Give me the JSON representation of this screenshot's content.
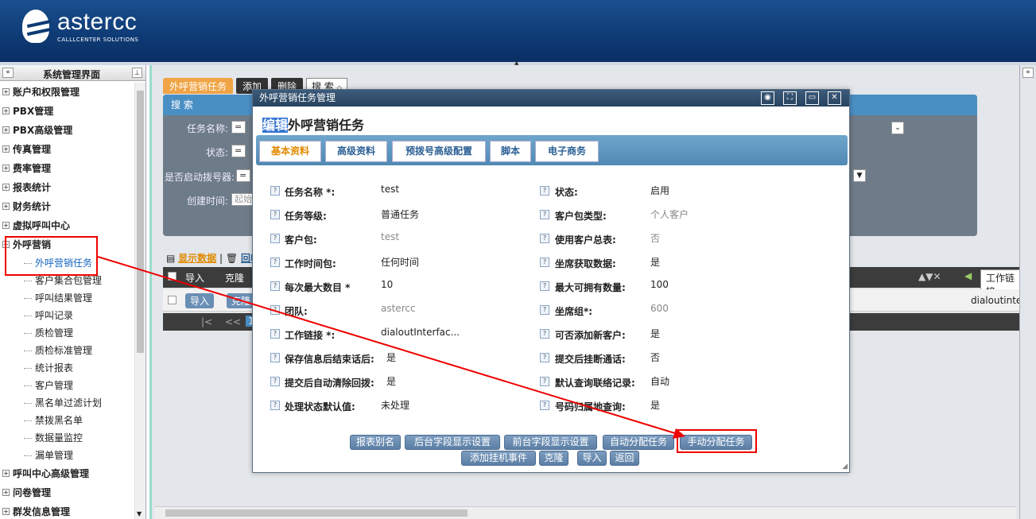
{
  "brand": {
    "name": "astercc",
    "tagline": "CALLLCENTER SOLUTIONS"
  },
  "sidebar": {
    "title": "系统管理界面",
    "items": [
      "账户和权限管理",
      "PBX管理",
      "PBX高级管理",
      "传真管理",
      "费率管理",
      "报表统计",
      "财务统计",
      "虚拟呼叫中心",
      "外呼营销"
    ],
    "subitems": [
      "外呼营销任务",
      "客户集合包管理",
      "呼叫结果管理",
      "呼叫记录",
      "质检管理",
      "质检标准管理",
      "统计报表",
      "客户管理",
      "黑名单过滤计划",
      "禁拨黑名单",
      "数据量监控",
      "漏单管理"
    ],
    "items_after": [
      "呼叫中心高级管理",
      "问卷管理",
      "群发信息管理"
    ]
  },
  "main": {
    "tab": "外呼营销任务",
    "add": "添加",
    "delete": "删除",
    "search_dropdown": "搜 索",
    "search_title": "搜 索",
    "filters": {
      "task_name": "任务名称:",
      "status": "状态:",
      "dialer_enabled": "是否启动拨号器:",
      "created": "创建时间:",
      "eq": "=",
      "start_placeholder": "起始"
    },
    "show_data": "显示数据",
    "recycle": "回收",
    "grid_import": "导入",
    "grid_clone": "克隆",
    "grid_link_col": "工作链接",
    "grid_link_val": "dialoutinte",
    "pager_first": "|<",
    "pager_prev": "<<",
    "pager_page": "1"
  },
  "modal": {
    "window_title": "外呼营销任务管理",
    "heading_highlight": "编辑",
    "heading_rest": "外呼营销任务",
    "tabs": [
      "基本资料",
      "高级资料",
      "预拨号高级配置",
      "脚本",
      "电子商务"
    ],
    "left_fields": [
      {
        "label": "任务名称 *:",
        "value": "test"
      },
      {
        "label": "任务等级:",
        "value": "普通任务"
      },
      {
        "label": "客户包:",
        "value": "test"
      },
      {
        "label": "工作时间包:",
        "value": "任何时间"
      },
      {
        "label": "每次最大数目 *",
        "value": "10"
      },
      {
        "label": "团队:",
        "value": "astercc"
      },
      {
        "label": "工作链接 *:",
        "value": "dialoutInterfac..."
      },
      {
        "label": "保存信息后结束话后:",
        "value": "是"
      },
      {
        "label": "提交后自动清除回拨:",
        "value": "是"
      },
      {
        "label": "处理状态默认值:",
        "value": "未处理"
      }
    ],
    "right_fields": [
      {
        "label": "状态:",
        "value": "启用"
      },
      {
        "label": "客户包类型:",
        "value": "个人客户"
      },
      {
        "label": "使用客户总表:",
        "value": "否"
      },
      {
        "label": "坐席获取数据:",
        "value": "是"
      },
      {
        "label": "最大可拥有数量:",
        "value": "100"
      },
      {
        "label": "坐席组*:",
        "value": "600"
      },
      {
        "label": "可否添加新客户:",
        "value": "是"
      },
      {
        "label": "提交后挂断通话:",
        "value": "否"
      },
      {
        "label": "默认查询联络记录:",
        "value": "自动"
      },
      {
        "label": "号码归属地查询:",
        "value": "是"
      }
    ],
    "buttons_row1": [
      "报表别名",
      "后台字段显示设置",
      "前台字段显示设置",
      "自动分配任务",
      "手动分配任务"
    ],
    "buttons_row2": [
      "添加挂机事件",
      "克隆",
      "导入",
      "返回"
    ]
  },
  "colors": {
    "annotation": "#e00000",
    "header": "#0e3a74",
    "active_tab": "#e08a00"
  }
}
